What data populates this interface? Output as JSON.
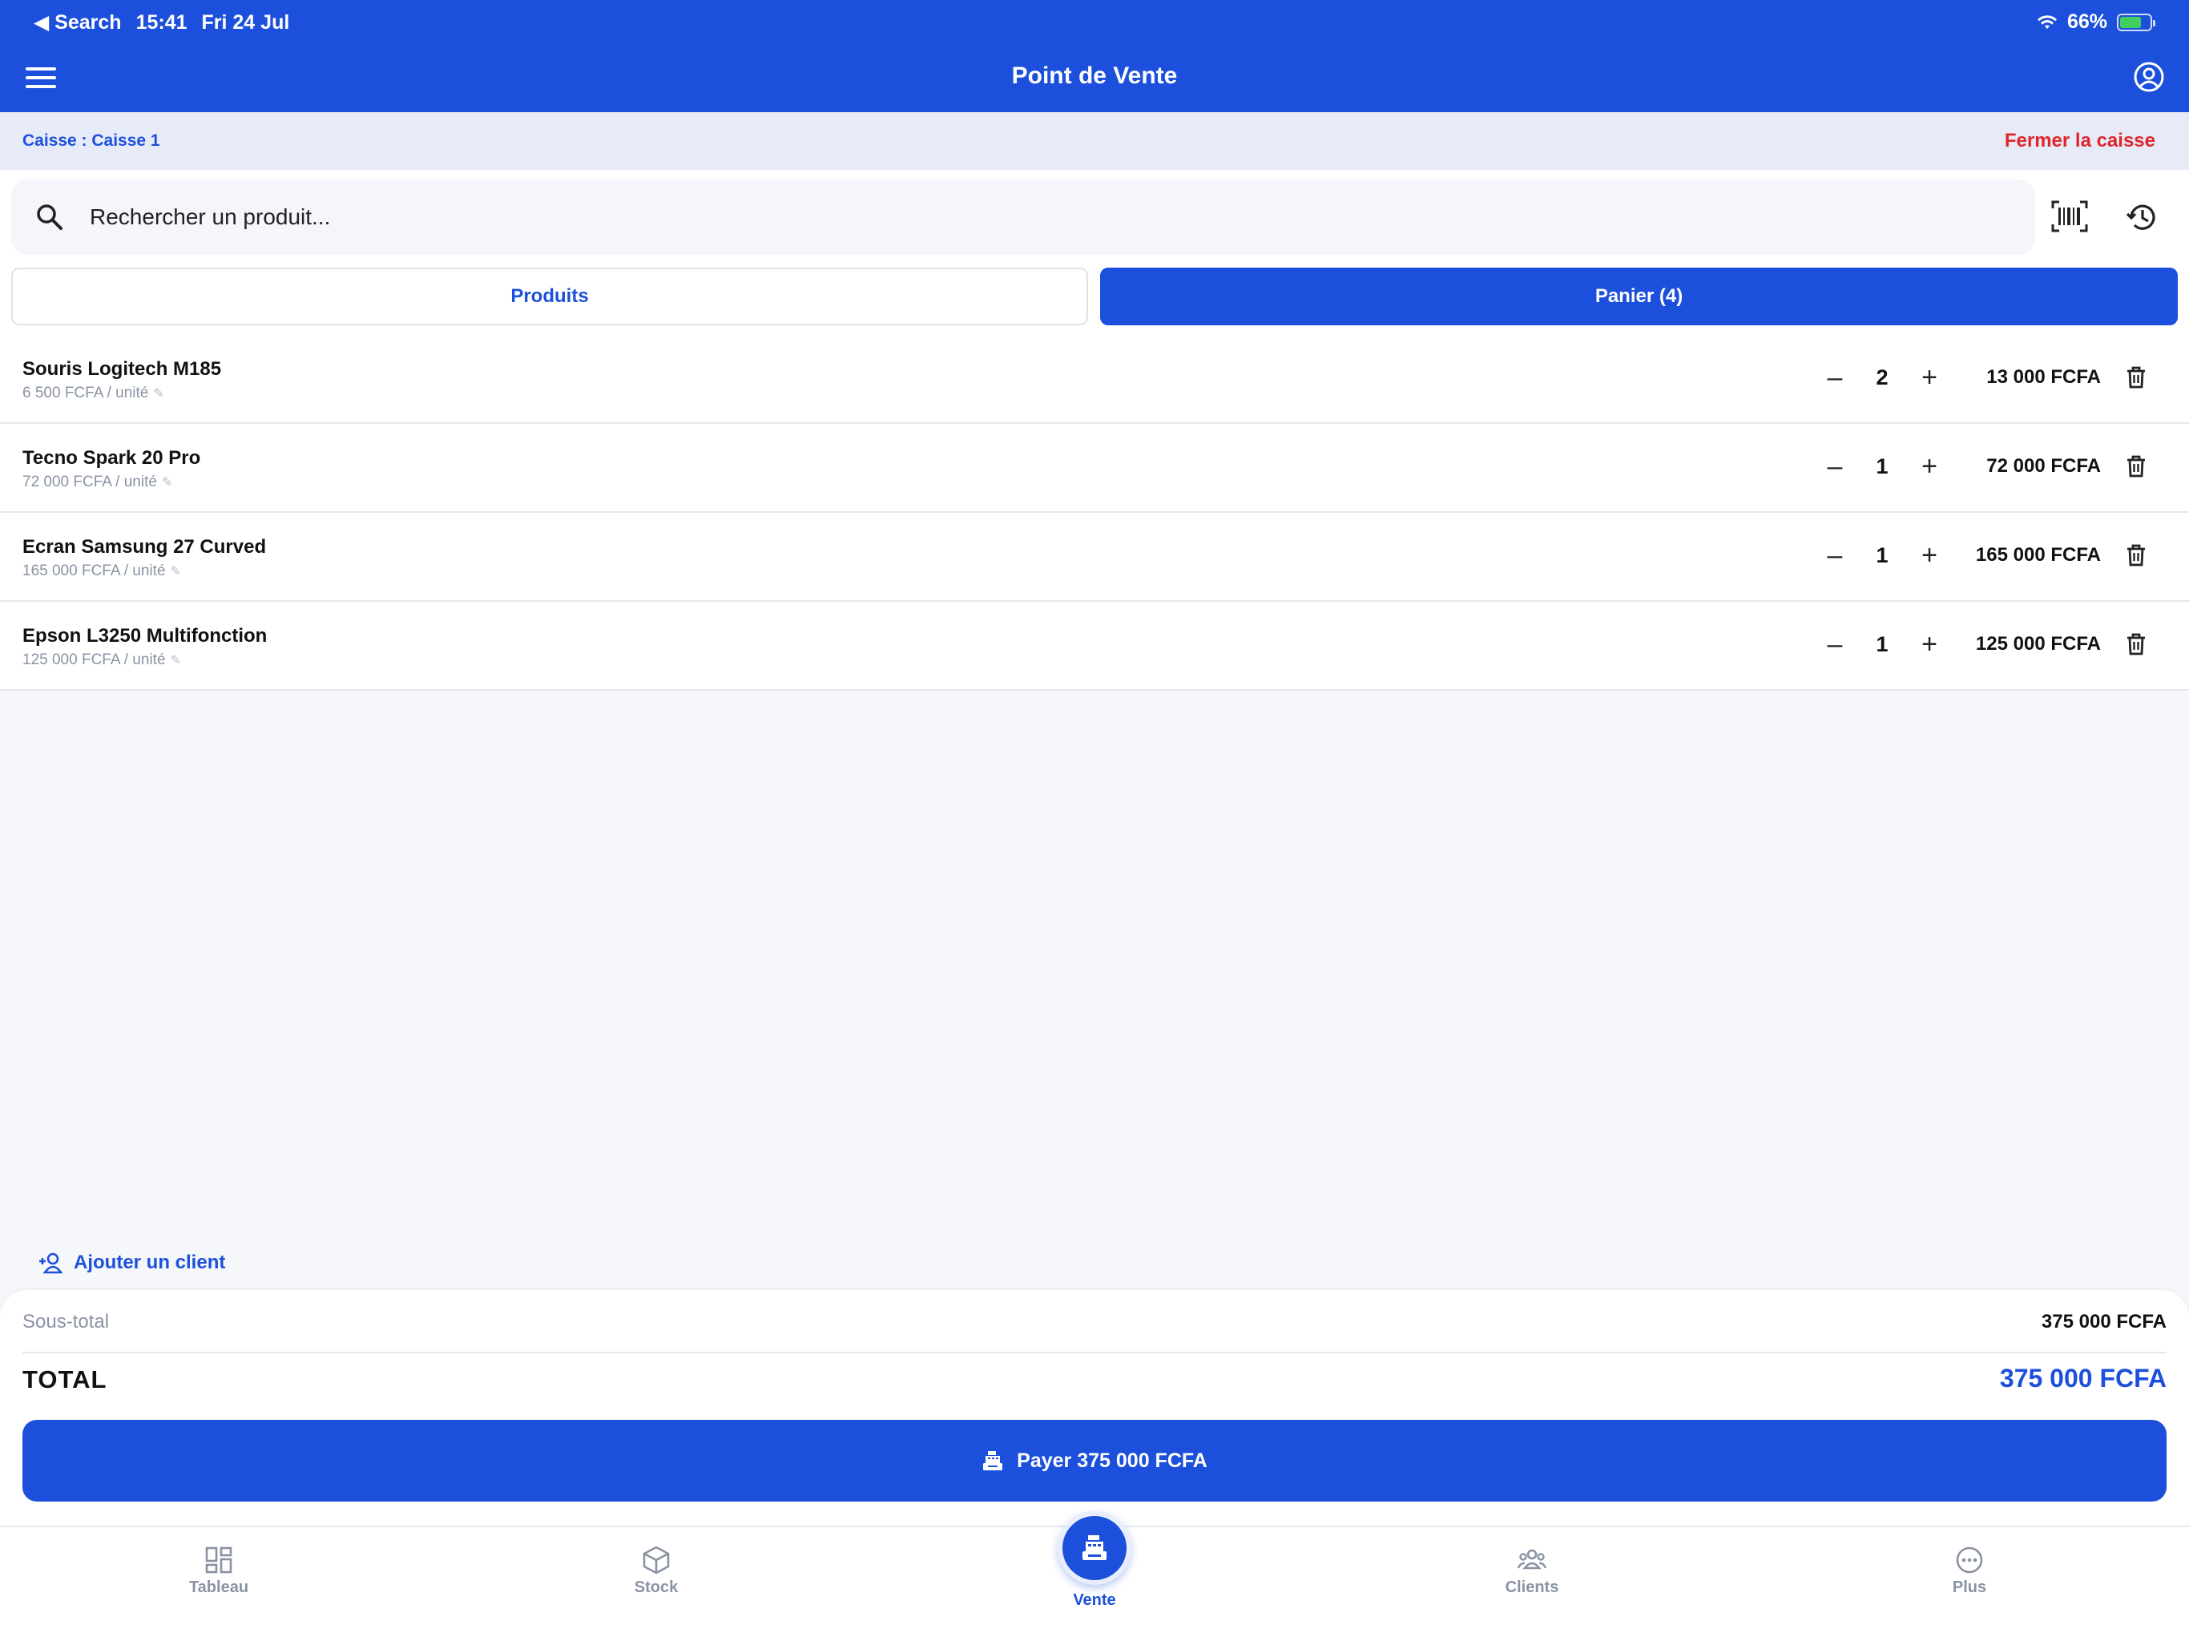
{
  "status_bar": {
    "back_label": "Search",
    "time": "15:41",
    "date": "Fri 24 Jul",
    "battery": "66%"
  },
  "header": {
    "title": "Point de Vente"
  },
  "caisse": {
    "label": "Caisse : Caisse 1",
    "close_label": "Fermer la caisse"
  },
  "search": {
    "placeholder": "Rechercher un produit..."
  },
  "tabs": [
    {
      "label": "Produits",
      "active": false
    },
    {
      "label": "Panier (4)",
      "active": true
    }
  ],
  "cart": {
    "items": [
      {
        "name": "Souris Logitech M185",
        "unit_price": "6 500 FCFA / unité",
        "qty": "2",
        "total": "13 000 FCFA"
      },
      {
        "name": "Tecno Spark 20 Pro",
        "unit_price": "72 000 FCFA / unité",
        "qty": "1",
        "total": "72 000 FCFA"
      },
      {
        "name": "Ecran Samsung 27 Curved",
        "unit_price": "165 000 FCFA / unité",
        "qty": "1",
        "total": "165 000 FCFA"
      },
      {
        "name": "Epson L3250 Multifonction",
        "unit_price": "125 000 FCFA / unité",
        "qty": "1",
        "total": "125 000 FCFA"
      }
    ],
    "minus_symbol": "–",
    "plus_symbol": "+"
  },
  "client": {
    "add_label": "Ajouter un client"
  },
  "summary": {
    "subtotal_label": "Sous-total",
    "subtotal_value": "375 000 FCFA",
    "total_label": "TOTAL",
    "total_value": "375 000 FCFA",
    "pay_label": "Payer 375 000 FCFA"
  },
  "bottom_nav": [
    {
      "label": "Tableau",
      "icon": "dashboard-icon"
    },
    {
      "label": "Stock",
      "icon": "box-icon"
    },
    {
      "label": "Vente",
      "icon": "cash-register-icon",
      "active": true
    },
    {
      "label": "Clients",
      "icon": "users-icon"
    },
    {
      "label": "Plus",
      "icon": "more-icon"
    }
  ],
  "colors": {
    "primary": "#1c50dc",
    "danger": "#e0262b",
    "muted": "#8a93a3",
    "background": "#f6f7fb"
  }
}
